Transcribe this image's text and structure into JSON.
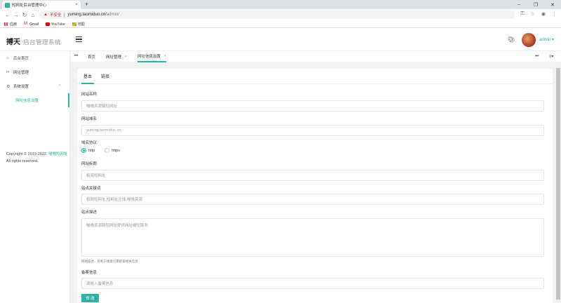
{
  "browser": {
    "tab_title": "短网址后台管理中心",
    "tab_close": "×",
    "new_tab": "+",
    "win_min": "–",
    "win_max": "❐",
    "win_close": "✕",
    "insecure_label": "不安全",
    "url_host": "yuming.taomiduo.cn",
    "url_path": "/admin/",
    "bookmarks": [
      {
        "label": "应用",
        "icon": "apps-grid-icon"
      },
      {
        "label": "Gmail",
        "icon": "gmail-icon"
      },
      {
        "label": "YouTube",
        "icon": "youtube-icon"
      },
      {
        "label": "地图",
        "icon": "maps-icon"
      }
    ]
  },
  "header": {
    "logo": "搏天",
    "logo_sub": "后台管理系统",
    "user": "admin ▾"
  },
  "sidebar": {
    "items": [
      {
        "label": "后台首页",
        "icon": "home-icon"
      },
      {
        "label": "网址管理",
        "icon": "link-icon"
      },
      {
        "label": "系统设置",
        "icon": "gear-icon"
      }
    ],
    "sub_active": "网址信息设置",
    "copyright_prefix": "Copyright © 2019-2022.",
    "copyright_link": "喵喵短网址",
    "copyright_suffix": " All rights reserved."
  },
  "page_tabs": [
    {
      "label": "首页"
    },
    {
      "label": "网址管理",
      "close": "×"
    },
    {
      "label": "网址信息设置",
      "close": "×"
    }
  ],
  "form": {
    "tabs": [
      "基本",
      "链接"
    ],
    "fields": {
      "site_name_label": "网站名称",
      "site_name_placeholder": "喵喵资源链短网址",
      "domain_label": "网站域名",
      "domain_placeholder": "yuming.taomiduo.cn",
      "protocol_label": "域名协议",
      "protocol_options": [
        "http",
        "https"
      ],
      "protocol_selected": "http",
      "site_title_label": "网站标题",
      "site_title_placeholder": "极简短网址",
      "keywords_label": "站点关键词",
      "keywords_placeholder": "极简短网址,短网址生成,喵喵资源",
      "desc_label": "站点描述",
      "desc_placeholder": "喵喵资源链短网址提供网址缩短服务",
      "desc_hint": "网站描述，有利于搜索引擎抓取相关信息",
      "icp_label": "备案信息",
      "icp_placeholder": "请输入备案信息",
      "submit_label": "修 改"
    }
  },
  "colors": {
    "accent": "#2bb5a0",
    "danger": "#c5221f"
  }
}
